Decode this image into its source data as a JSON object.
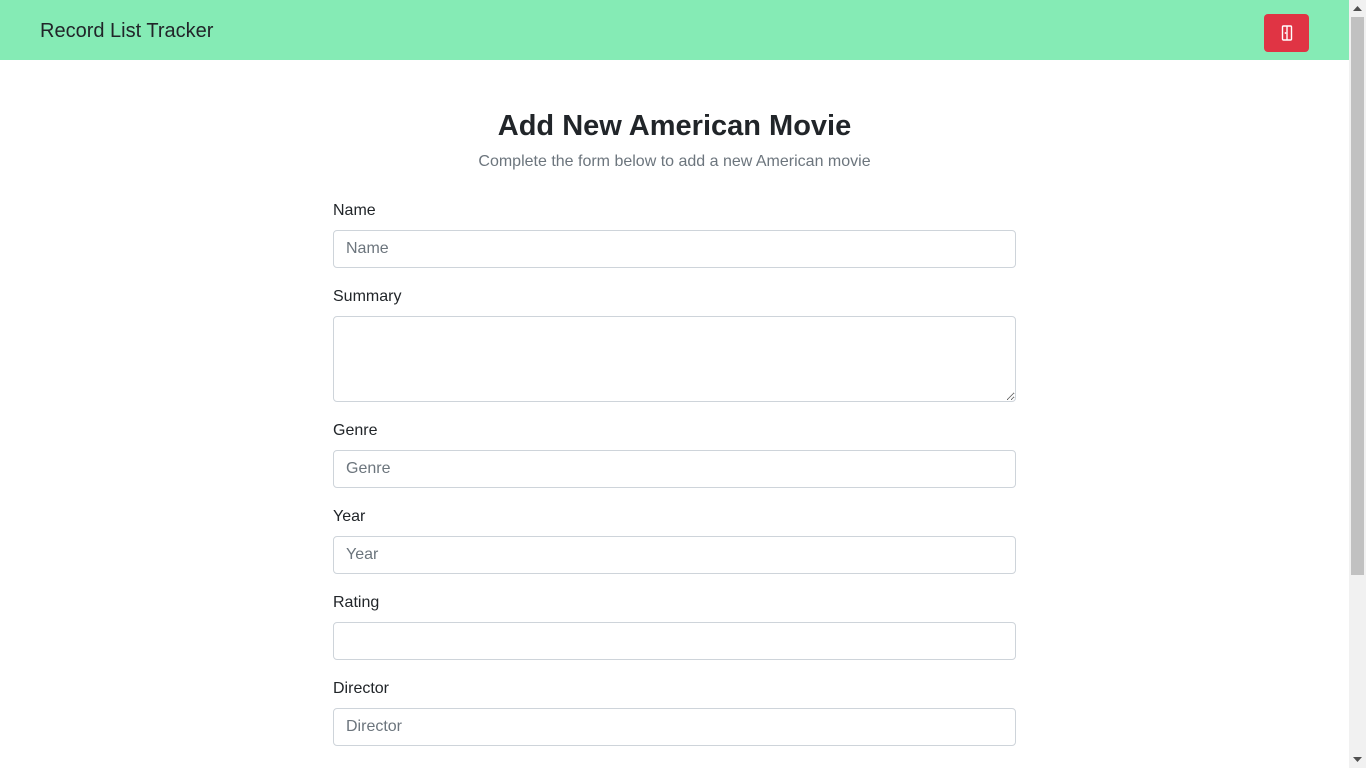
{
  "navbar": {
    "brand": "Record List Tracker",
    "logout_icon": "logout-icon",
    "background_color": "#85ebb5",
    "logout_button_color": "#e03444"
  },
  "header": {
    "title": "Add New American Movie",
    "subtitle": "Complete the form below to add a new American movie"
  },
  "form": {
    "name": {
      "label": "Name",
      "placeholder": "Name",
      "value": ""
    },
    "summary": {
      "label": "Summary",
      "placeholder": "",
      "value": ""
    },
    "genre": {
      "label": "Genre",
      "placeholder": "Genre",
      "value": ""
    },
    "year": {
      "label": "Year",
      "placeholder": "Year",
      "value": ""
    },
    "rating": {
      "label": "Rating",
      "placeholder": "",
      "value": ""
    },
    "director": {
      "label": "Director",
      "placeholder": "Director",
      "value": ""
    }
  }
}
